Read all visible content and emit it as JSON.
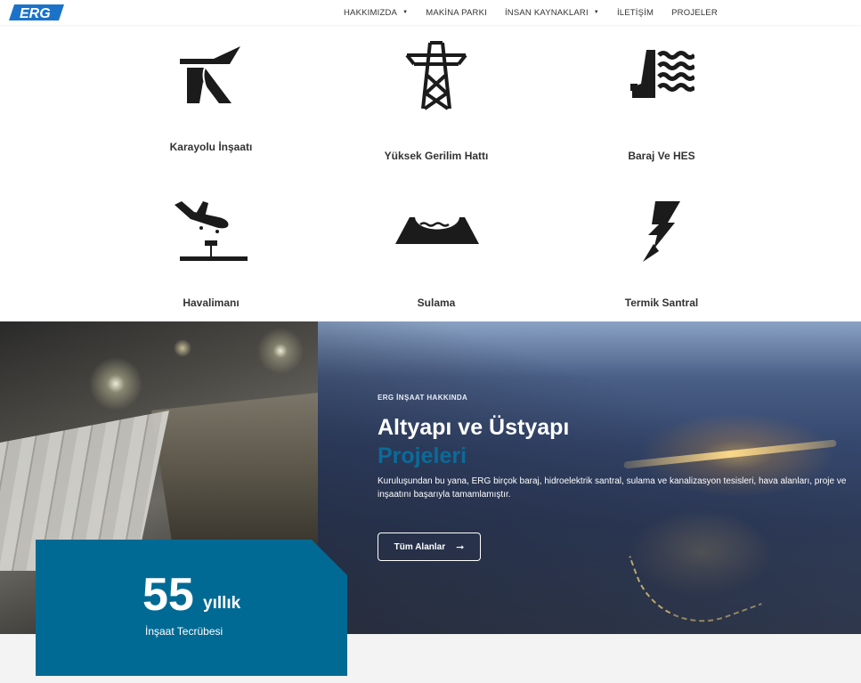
{
  "nav": {
    "logo_text": "ERG",
    "items": [
      {
        "label": "HAKKIMIZDA",
        "has_dropdown": true
      },
      {
        "label": "MAKİNA PARKI",
        "has_dropdown": false
      },
      {
        "label": "İNSAN KAYNAKLARI",
        "has_dropdown": true
      },
      {
        "label": "İLETİŞİM",
        "has_dropdown": false
      },
      {
        "label": "PROJELER",
        "has_dropdown": false
      }
    ]
  },
  "services": [
    {
      "label": "Karayolu İnşaatı",
      "icon": "highway-icon"
    },
    {
      "label": "Yüksek Gerilim Hattı",
      "icon": "power-tower-icon"
    },
    {
      "label": "Baraj Ve HES",
      "icon": "dam-icon"
    },
    {
      "label": "Havalimanı",
      "icon": "airplane-landing-icon"
    },
    {
      "label": "Sulama",
      "icon": "irrigation-icon"
    },
    {
      "label": "Termik Santral",
      "icon": "lightning-icon"
    }
  ],
  "hero": {
    "kicker": "ERG İNŞAAT HAKKINDA",
    "title_line1": "Altyapı ve Üstyapı",
    "title_line2": "Projeleri",
    "description": "Kuruluşundan bu yana, ERG birçok baraj, hidroelektrik santral, sulama ve kanalizasyon tesisleri, hava alanları, proje ve inşaatını başarıyla tamamlamıştır.",
    "button_label": "Tüm Alanlar"
  },
  "experience": {
    "number": "55",
    "unit": "yıllık",
    "label": "İnşaat Tecrübesi"
  },
  "colors": {
    "brand_blue": "#006a94",
    "accent_blue": "#0a6b9a",
    "icon_dark": "#1b1b1b"
  }
}
